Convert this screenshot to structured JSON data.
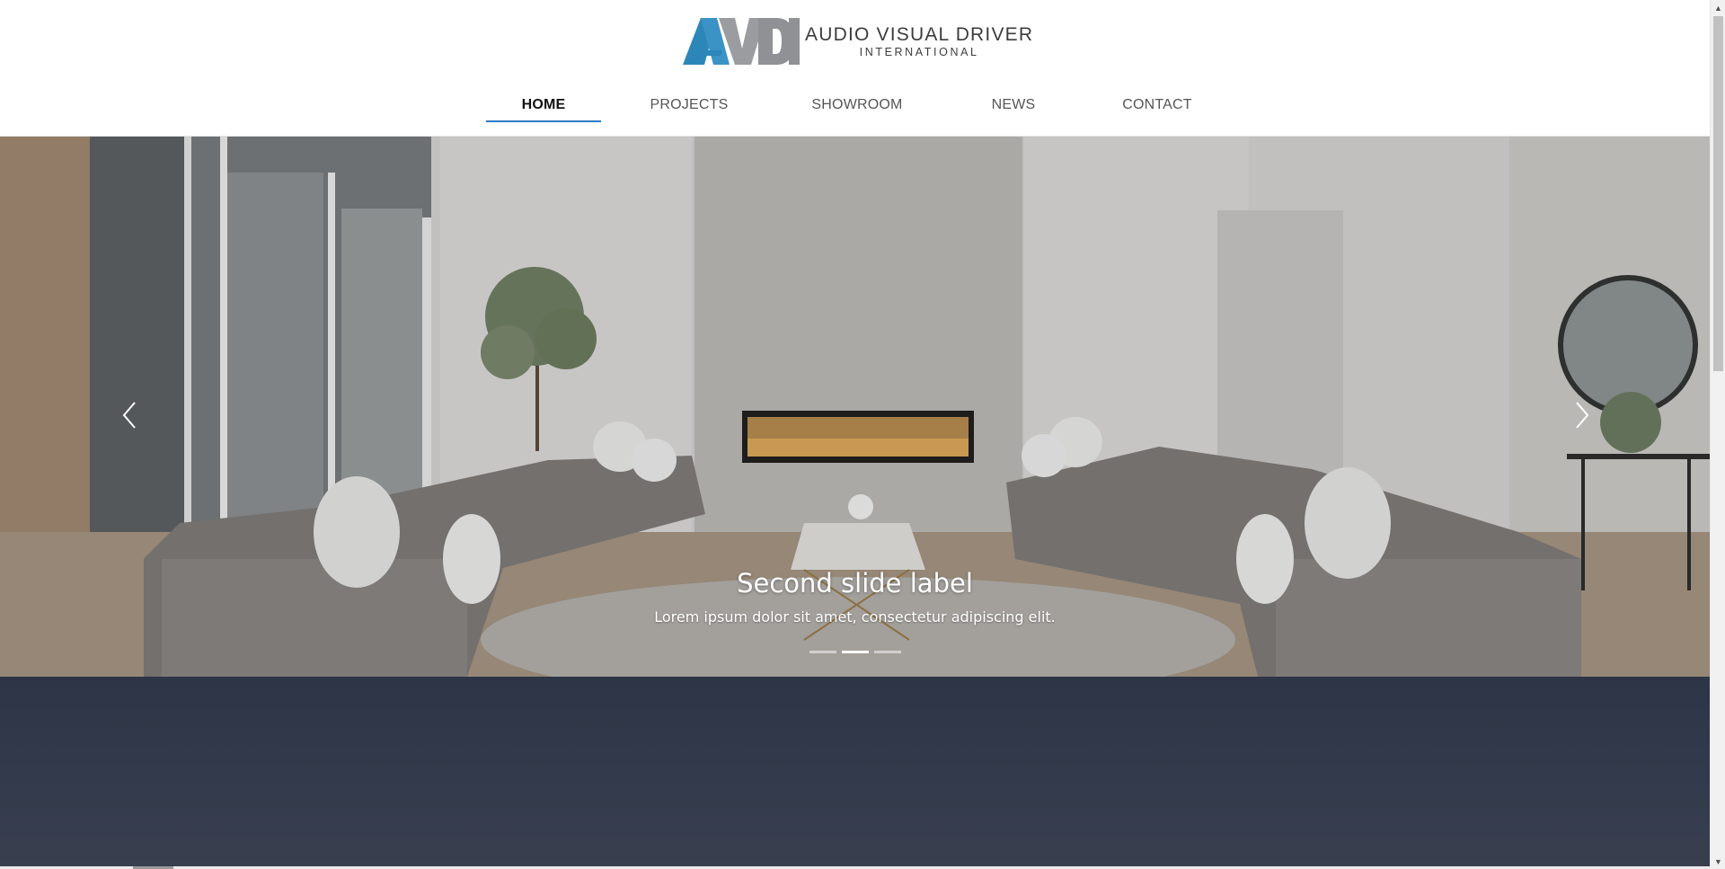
{
  "brand": {
    "line1": "AUDIO VISUAL DRIVER",
    "line2": "INTERNATIONAL",
    "colors": {
      "blue": "#2c86b8",
      "gray": "#8f9194",
      "dark": "#3c3c3c"
    }
  },
  "nav": {
    "items": [
      {
        "label": "HOME",
        "active": true
      },
      {
        "label": "PROJECTS",
        "active": false
      },
      {
        "label": "SHOWROOM",
        "active": false
      },
      {
        "label": "NEWS",
        "active": false
      },
      {
        "label": "CONTACT",
        "active": false
      }
    ],
    "active_color": "#2e7bc4"
  },
  "carousel": {
    "caption_title": "Second slide label",
    "caption_text": "Lorem ipsum dolor sit amet, consectetur adipiscing elit.",
    "slide_count": 3,
    "active_index": 1,
    "prev_icon": "chevron-left-icon",
    "next_icon": "chevron-right-icon"
  },
  "dark_section": {
    "color": "#2d3546"
  }
}
